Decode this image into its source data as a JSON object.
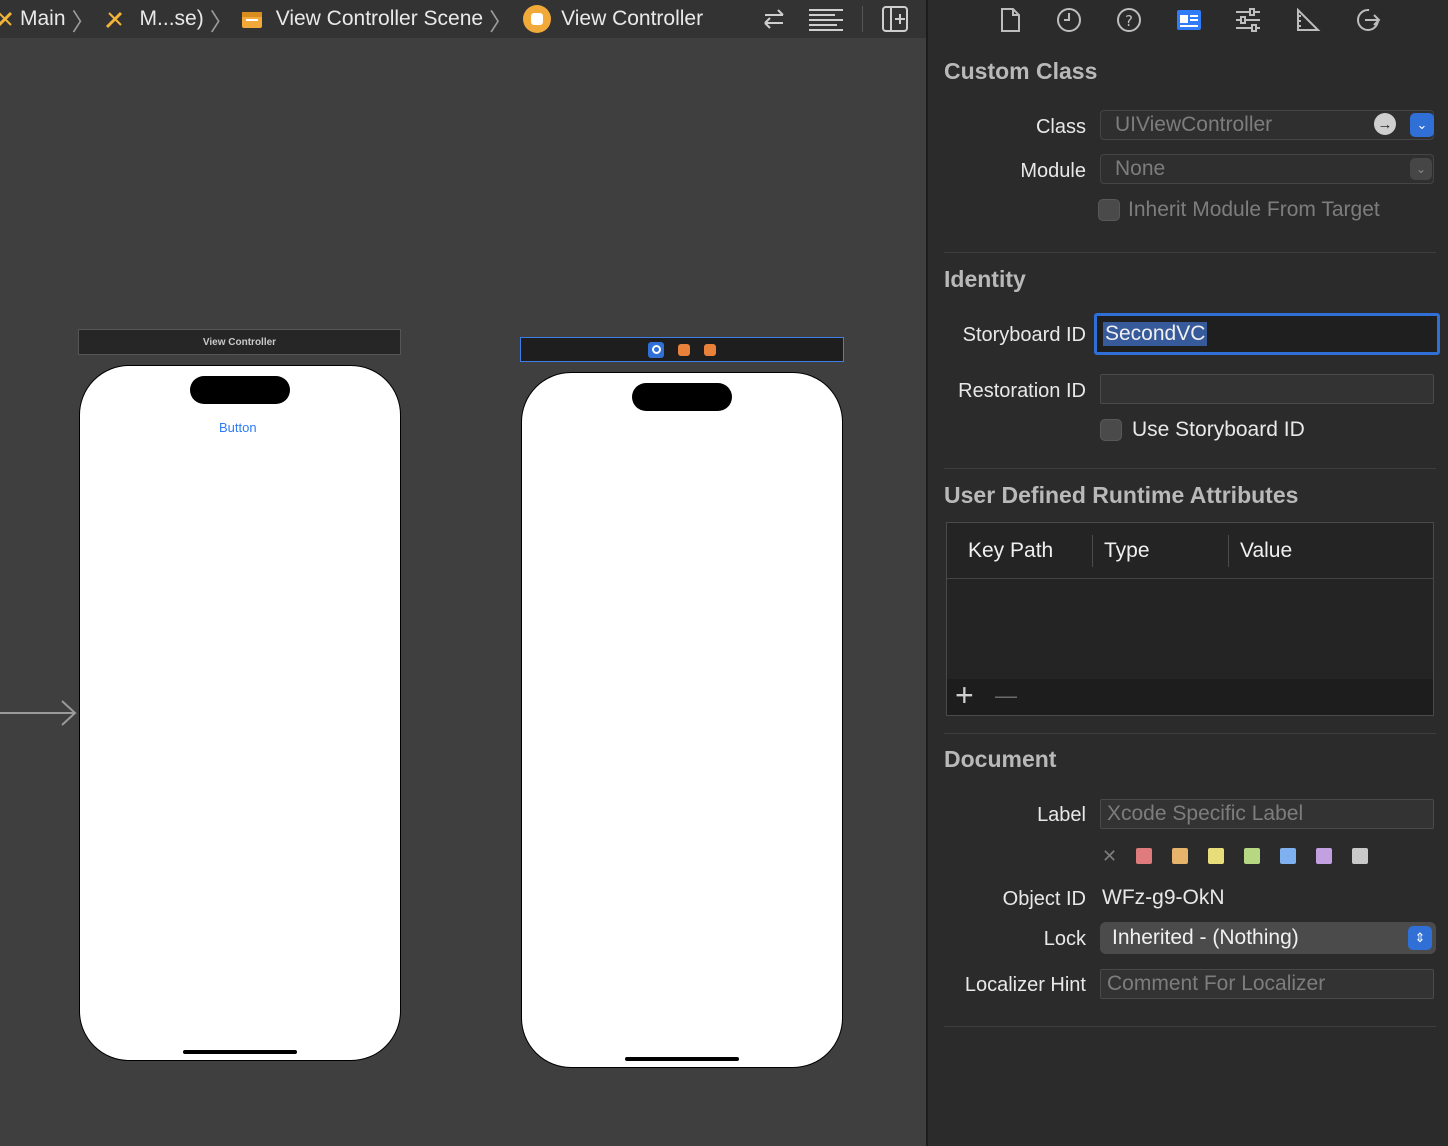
{
  "jumpbar": {
    "crumbs": [
      "Main",
      "M...se)",
      "View Controller Scene",
      "View Controller"
    ]
  },
  "canvas": {
    "scene1_title": "View Controller",
    "scene1_button": "Button"
  },
  "inspector": {
    "custom_class": {
      "title": "Custom Class",
      "class_label": "Class",
      "class_placeholder": "UIViewController",
      "module_label": "Module",
      "module_placeholder": "None",
      "inherit_label": "Inherit Module From Target"
    },
    "identity": {
      "title": "Identity",
      "storyboard_id_label": "Storyboard ID",
      "storyboard_id_value": "SecondVC",
      "restoration_id_label": "Restoration ID",
      "restoration_id_value": "",
      "use_storyboard_id_label": "Use Storyboard ID"
    },
    "runtime_attributes": {
      "title": "User Defined Runtime Attributes",
      "columns": [
        "Key Path",
        "Type",
        "Value"
      ],
      "add_label": "+",
      "remove_label": "—"
    },
    "document": {
      "title": "Document",
      "label_label": "Label",
      "label_placeholder": "Xcode Specific Label",
      "clear_label": "✕",
      "object_id_label": "Object ID",
      "object_id_value": "WFz-g9-OkN",
      "lock_label": "Lock",
      "lock_value": "Inherited - (Nothing)",
      "localizer_label": "Localizer Hint",
      "localizer_placeholder": "Comment For Localizer"
    },
    "label_colors": [
      "#e07b7b",
      "#e6b46a",
      "#e7dd79",
      "#b6d882",
      "#7fb0ef",
      "#c3a0e0",
      "#c9c9c9"
    ]
  }
}
